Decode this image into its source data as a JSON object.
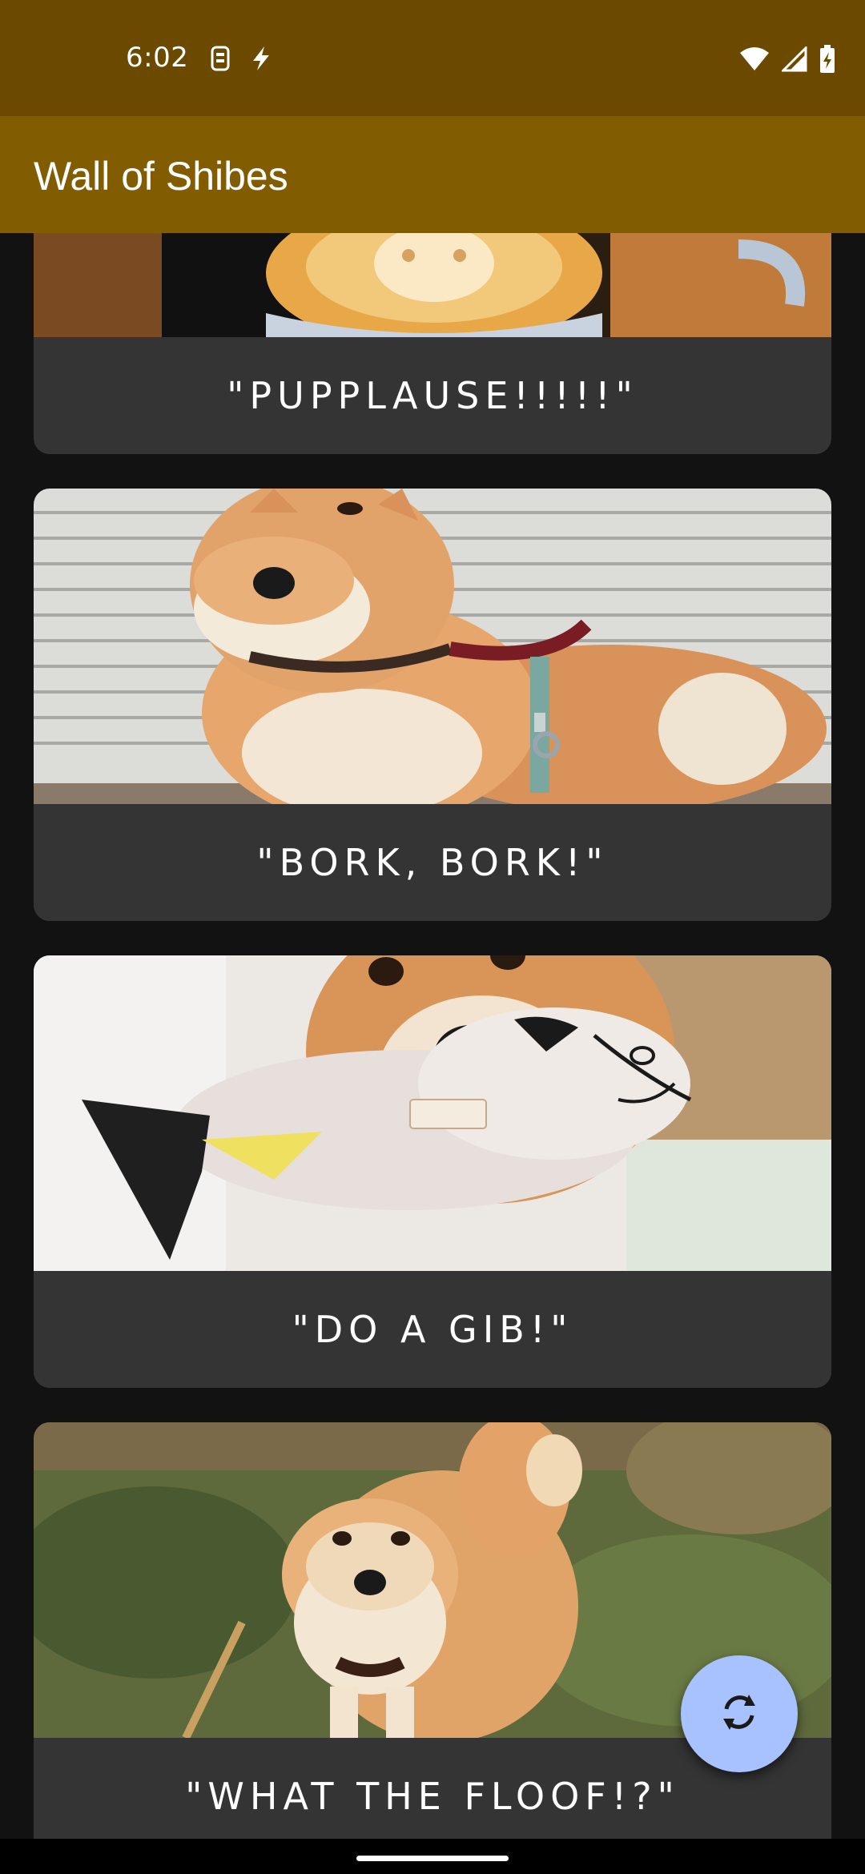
{
  "status_bar": {
    "time": "6:02",
    "left_icons": [
      "sim-card-icon",
      "charging-bolt-icon"
    ],
    "right_icons": [
      "wifi-icon",
      "cellular-signal-icon",
      "battery-charging-icon"
    ]
  },
  "app_bar": {
    "title": "Wall of Shibes"
  },
  "cards": [
    {
      "caption": "\"PUPPLAUSE!!!!!\"",
      "image": "panda latte art in a coffee cup"
    },
    {
      "caption": "\"BORK, BORK!\"",
      "image": "shiba inu with red harness by a white shutter"
    },
    {
      "caption": "\"DO A GIB!\"",
      "image": "shiba inu holding a plush fish toy"
    },
    {
      "caption": "\"WHAT THE FLOOF!?\"",
      "image": "shiba inu standing on grass"
    }
  ],
  "fab": {
    "icon": "refresh-icon"
  },
  "colors": {
    "status_bar": "#6b4a00",
    "app_bar": "#825c00",
    "background": "#121212",
    "card": "#343434",
    "fab": "#a7c2ff"
  }
}
